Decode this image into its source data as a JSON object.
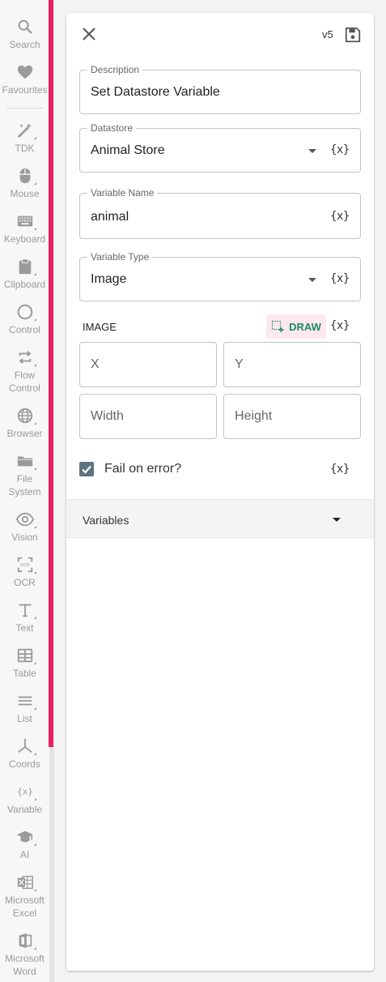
{
  "sidebar": {
    "items": [
      {
        "label": "Search",
        "icon": "search-icon"
      },
      {
        "label": "Favourites",
        "icon": "heart-icon"
      },
      {
        "label": "TDK",
        "icon": "magic-wand-icon"
      },
      {
        "label": "Mouse",
        "icon": "mouse-icon"
      },
      {
        "label": "Keyboard",
        "icon": "keyboard-icon"
      },
      {
        "label": "Clipboard",
        "icon": "clipboard-icon"
      },
      {
        "label": "Control",
        "icon": "circle-icon"
      },
      {
        "label": "Flow\nControl",
        "icon": "repeat-icon"
      },
      {
        "label": "Browser",
        "icon": "globe-icon"
      },
      {
        "label": "File\nSystem",
        "icon": "folder-icon"
      },
      {
        "label": "Vision",
        "icon": "eye-icon"
      },
      {
        "label": "OCR",
        "icon": "ocr-icon"
      },
      {
        "label": "Text",
        "icon": "text-icon"
      },
      {
        "label": "Table",
        "icon": "table-icon"
      },
      {
        "label": "List",
        "icon": "list-icon"
      },
      {
        "label": "Coords",
        "icon": "coords-icon"
      },
      {
        "label": "Variable",
        "icon": "variable-icon"
      },
      {
        "label": "AI",
        "icon": "graduation-cap-icon"
      },
      {
        "label": "Microsoft\nExcel",
        "icon": "excel-icon"
      },
      {
        "label": "Microsoft\nWord",
        "icon": "word-icon"
      }
    ],
    "accent_color": "#e91e63"
  },
  "panel": {
    "version": "v5",
    "description": {
      "legend": "Description",
      "value": "Set Datastore Variable"
    },
    "datastore": {
      "legend": "Datastore",
      "value": "Animal Store"
    },
    "variable_name": {
      "legend": "Variable Name",
      "value": "animal"
    },
    "variable_type": {
      "legend": "Variable Type",
      "value": "Image"
    },
    "variable_token": "{x}",
    "image_section": {
      "label": "IMAGE",
      "draw_label": "DRAW",
      "x_placeholder": "X",
      "y_placeholder": "Y",
      "width_placeholder": "Width",
      "height_placeholder": "Height"
    },
    "fail_on_error": {
      "label": "Fail on error?",
      "checked": true
    },
    "variables_section": {
      "title": "Variables"
    }
  },
  "colors": {
    "draw_text": "#1b8a6b",
    "draw_bg": "#fde8ee",
    "checkbox": "#5f7380",
    "green_tab": "#1b9e77"
  }
}
